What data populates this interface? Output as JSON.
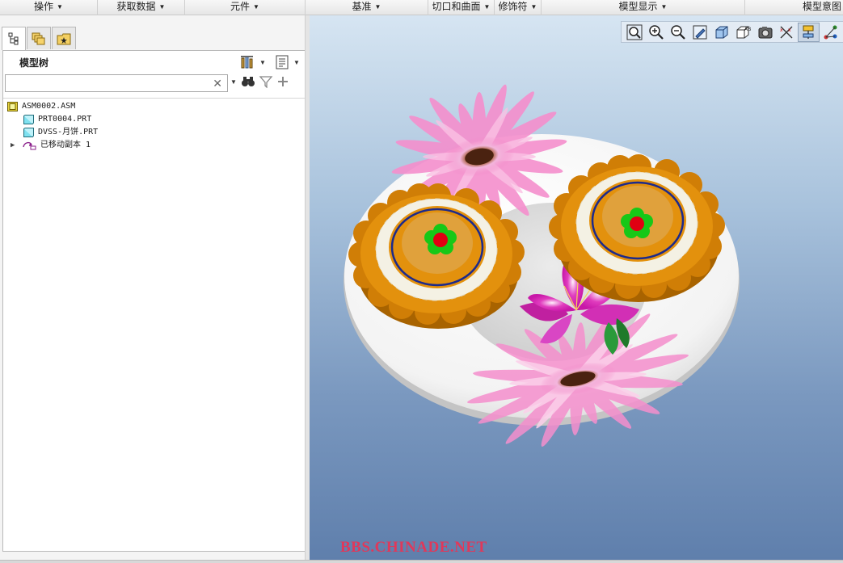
{
  "ribbon": {
    "groups": [
      {
        "label": "操作"
      },
      {
        "label": "获取数据"
      },
      {
        "label": "元件"
      },
      {
        "label": "基准"
      },
      {
        "label": "切口和曲面"
      },
      {
        "label": "修饰符"
      },
      {
        "label": "模型显示"
      },
      {
        "label": "模型意图"
      }
    ]
  },
  "panel": {
    "tabs": [
      {
        "icon": "model-tree-icon"
      },
      {
        "icon": "layers-icon"
      },
      {
        "icon": "favorites-folder-icon"
      }
    ],
    "title": "模型树",
    "search": {
      "value": "",
      "placeholder": ""
    },
    "tools": [
      "settings-icon",
      "show-list-icon",
      "find-binoculars-icon",
      "filter-icon",
      "add-icon"
    ]
  },
  "tree": {
    "items": [
      {
        "label": "ASM0002.ASM",
        "icon": "assembly-icon"
      },
      {
        "label": "PRT0004.PRT",
        "icon": "part-icon"
      },
      {
        "label": "DVSS-月饼.PRT",
        "icon": "part-icon"
      },
      {
        "label": "已移动副本 1",
        "icon": "moved-copy-icon",
        "expandable": true
      }
    ]
  },
  "graphics_toolbar": {
    "tools": [
      {
        "icon": "refit-icon"
      },
      {
        "icon": "zoom-in-icon"
      },
      {
        "icon": "zoom-out-icon"
      },
      {
        "icon": "repaint-icon"
      },
      {
        "icon": "display-style-icon"
      },
      {
        "icon": "saved-orientations-icon"
      },
      {
        "icon": "view-manager-icon"
      },
      {
        "icon": "datum-display-filters-icon"
      },
      {
        "icon": "annotation-display-icon",
        "pressed": true
      },
      {
        "icon": "spin-center-icon"
      }
    ]
  },
  "watermark": {
    "text": "BBS.CHINADE.NET"
  },
  "colors": {
    "viewport_top": "#d6e5f2",
    "viewport_bottom": "#5f7fac",
    "cake_orange": "#e3910d",
    "cake_rim": "#d07e06",
    "cake_ring": "#1c2a8c",
    "flower_green": "#17c817",
    "flower_red": "#e00012",
    "plate_white": "#f7f7f7",
    "petal_pink": "#f08ac8",
    "watermark": "#e0385a"
  }
}
